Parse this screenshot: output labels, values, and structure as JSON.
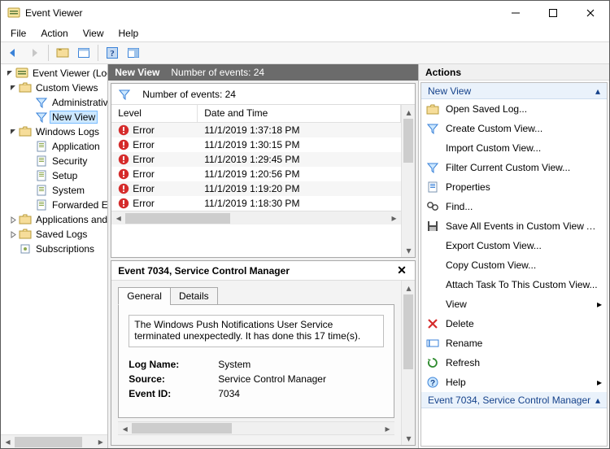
{
  "window": {
    "title": "Event Viewer"
  },
  "menubar": [
    "File",
    "Action",
    "View",
    "Help"
  ],
  "tree": {
    "root": "Event Viewer (Local)",
    "custom_views": "Custom Views",
    "admin_events": "Administrative Events",
    "new_view": "New View",
    "windows_logs": "Windows Logs",
    "application": "Application",
    "security": "Security",
    "setup": "Setup",
    "system": "System",
    "forwarded": "Forwarded Events",
    "apps_services": "Applications and Services Logs",
    "saved_logs": "Saved Logs",
    "subscriptions": "Subscriptions"
  },
  "center": {
    "view_name": "New View",
    "events_label": "Number of events: 24",
    "filter_events_label": "Number of events: 24",
    "columns": {
      "level": "Level",
      "date": "Date and Time"
    },
    "rows": [
      {
        "level": "Error",
        "date": "11/1/2019 1:37:18 PM"
      },
      {
        "level": "Error",
        "date": "11/1/2019 1:30:15 PM"
      },
      {
        "level": "Error",
        "date": "11/1/2019 1:29:45 PM"
      },
      {
        "level": "Error",
        "date": "11/1/2019 1:20:56 PM"
      },
      {
        "level": "Error",
        "date": "11/1/2019 1:19:20 PM"
      },
      {
        "level": "Error",
        "date": "11/1/2019 1:18:30 PM"
      }
    ]
  },
  "detail": {
    "title": "Event 7034, Service Control Manager",
    "tabs": {
      "general": "General",
      "details": "Details"
    },
    "message": "The Windows Push Notifications User Service terminated unexpectedly. It has done this 17 time(s).",
    "props": {
      "log_name_label": "Log Name:",
      "log_name": "System",
      "source_label": "Source:",
      "source": "Service Control Manager",
      "event_id_label": "Event ID:",
      "event_id": "7034"
    }
  },
  "actions": {
    "title": "Actions",
    "group1": "New View",
    "items1": [
      {
        "id": "open-saved-log",
        "label": "Open Saved Log...",
        "icon": "folder"
      },
      {
        "id": "create-custom-view",
        "label": "Create Custom View...",
        "icon": "funnel"
      },
      {
        "id": "import-custom-view",
        "label": "Import Custom View...",
        "icon": "blank"
      },
      {
        "id": "filter-current",
        "label": "Filter Current Custom View...",
        "icon": "funnel"
      },
      {
        "id": "properties",
        "label": "Properties",
        "icon": "props"
      },
      {
        "id": "find",
        "label": "Find...",
        "icon": "find"
      },
      {
        "id": "save-all",
        "label": "Save All Events in Custom View As...",
        "icon": "save"
      },
      {
        "id": "export",
        "label": "Export Custom View...",
        "icon": "blank"
      },
      {
        "id": "copy",
        "label": "Copy Custom View...",
        "icon": "blank"
      },
      {
        "id": "attach-task",
        "label": "Attach Task To This Custom View...",
        "icon": "blank"
      },
      {
        "id": "view",
        "label": "View",
        "icon": "blank",
        "submenu": true
      },
      {
        "id": "delete",
        "label": "Delete",
        "icon": "delete"
      },
      {
        "id": "rename",
        "label": "Rename",
        "icon": "rename"
      },
      {
        "id": "refresh",
        "label": "Refresh",
        "icon": "refresh"
      },
      {
        "id": "help",
        "label": "Help",
        "icon": "help",
        "submenu": true
      }
    ],
    "group2": "Event 7034, Service Control Manager"
  }
}
